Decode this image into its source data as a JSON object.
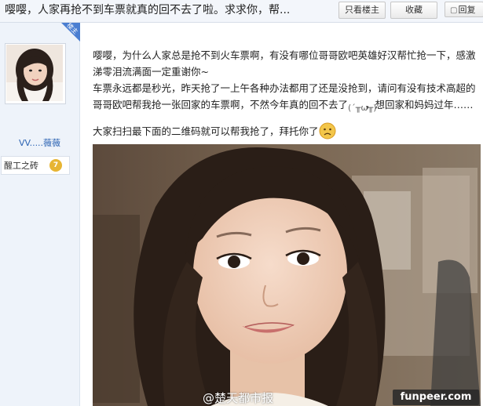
{
  "header": {
    "title": "嘤嘤，人家再抢不到车票就真的回不去了啦。求求你，帮...",
    "only_op_label": "只看楼主",
    "favorite_label": "收藏",
    "reply_label": "回复"
  },
  "user": {
    "op_badge": "楼主",
    "name": "VV.....薇薇",
    "level_name": "醒工之砖",
    "level": "7"
  },
  "post": {
    "para1": "嘤嘤，为什么人家总是抢不到火车票啊，有没有哪位哥哥欧吧英雄好汉帮忙抢一下，感激涕零泪流满面一定重谢你~",
    "para2a": "车票永远都是秒光，昨天抢了一上午各种办法都用了还是没抢到，请问有没有技术高超的哥哥欧吧帮我抢一张回家的车票啊，不然今年真的回不去了",
    "para2b": "，想回家和妈妈过年……",
    "para3": "大家扫扫最下面的二维码就可以帮我抢了，拜托你了"
  },
  "photo": {
    "watermark": "@楚天都市报",
    "site_badge": "funpeer.com"
  },
  "colors": {
    "accent": "#2d64b3",
    "op_badge": "#4a7ed1",
    "header_bg": "#f3f6fb"
  }
}
